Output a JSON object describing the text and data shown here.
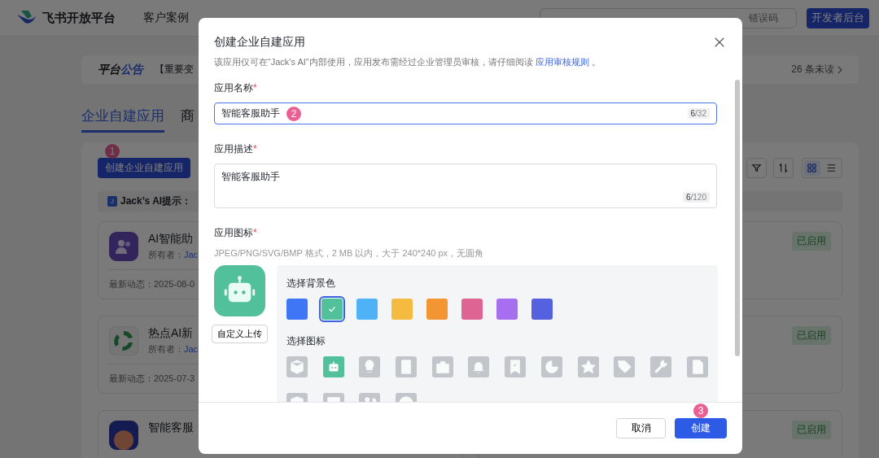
{
  "header": {
    "brand": "飞书开放平台",
    "nav": [
      "客户案例"
    ],
    "search": {
      "placeholder": "错误码"
    },
    "console_button": "开发者后台"
  },
  "announcement": {
    "label_plain": "平台",
    "label_accent": "公告",
    "text": "【重要变",
    "unread": "26 条未读"
  },
  "tabs": [
    {
      "label": "企业自建应用",
      "selected": true
    },
    {
      "label": "商",
      "selected": false
    }
  ],
  "create_button": "创建企业自建应用",
  "view_toggle": [
    {
      "selected": true
    },
    {
      "selected": false
    }
  ],
  "hint": {
    "avatar": "J",
    "text": "Jack’s AI提示："
  },
  "apps": [
    {
      "name": "AI智能助",
      "owner_label": "所有者：",
      "owner": "Jac",
      "activity": "最新动态：2025-08-0",
      "status": "已启用"
    },
    {
      "name": "热点AI新",
      "owner_label": "所有者：",
      "owner": "Jac",
      "activity": "最新动态：2025-07-3",
      "status": "已启用"
    },
    {
      "name": "智能客服",
      "status": "已启用"
    }
  ],
  "steps": [
    "1",
    "2",
    "3"
  ],
  "dialog": {
    "title": "创建企业自建应用",
    "subtitle": "该应用仅可在“Jack’s AI”内部使用，应用发布需经过企业管理员审核，请仔细阅读",
    "subtitle_link": "应用审核规则",
    "subtitle_end": "。",
    "required_mark": "*",
    "name_label": "应用名称",
    "name_value": "智能客服助手",
    "name_count": "6",
    "name_max": "/32",
    "desc_label": "应用描述",
    "desc_value": "智能客服助手",
    "desc_count": "6",
    "desc_max": "/120",
    "icon_label": "应用图标",
    "icon_hint": "JPEG/PNG/SVG/BMP 格式，2 MB 以内，大于 240*240 px，无圆角",
    "upload_button": "自定义上传",
    "bg_title": "选择背景色",
    "colors": [
      {
        "color": "#3f76f5",
        "selected": false
      },
      {
        "color": "#52c09a",
        "selected": true
      },
      {
        "color": "#4fb2f7",
        "selected": false
      },
      {
        "color": "#f5ba40",
        "selected": false
      },
      {
        "color": "#f39532",
        "selected": false
      },
      {
        "color": "#de6493",
        "selected": false
      },
      {
        "color": "#a56ff0",
        "selected": false
      },
      {
        "color": "#5562e0",
        "selected": false
      }
    ],
    "icons_title": "选择图标",
    "icons": [
      {
        "selected": false
      },
      {
        "selected": true
      },
      {
        "selected": false
      },
      {
        "selected": false
      },
      {
        "selected": false
      },
      {
        "selected": false
      },
      {
        "selected": false
      },
      {
        "selected": false
      },
      {
        "selected": false
      },
      {
        "selected": false
      },
      {
        "selected": false
      },
      {
        "selected": false
      },
      {
        "selected": false
      },
      {
        "selected": false
      },
      {
        "selected": false
      },
      {
        "selected": false
      }
    ],
    "cancel": "取消",
    "confirm": "创建"
  }
}
